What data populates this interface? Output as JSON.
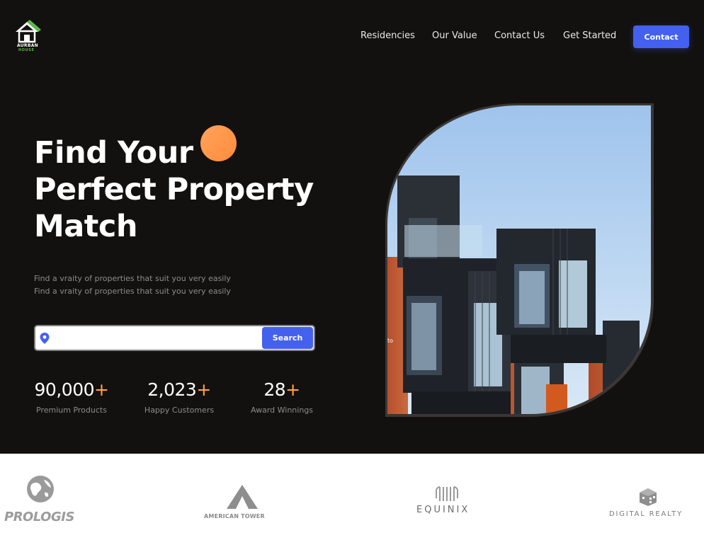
{
  "brand": {
    "name_line1": "AURBAN",
    "name_line2": "HOUSE",
    "accent_green": "#5db94a"
  },
  "nav": {
    "items": [
      {
        "label": "Residencies"
      },
      {
        "label": "Our Value"
      },
      {
        "label": "Contact Us"
      },
      {
        "label": "Get Started"
      }
    ],
    "cta_label": "Contact"
  },
  "hero": {
    "title_line1": "Find Your",
    "title_line2": "Perfect Property",
    "title_line3": "Match",
    "subtitle_line1": "Find a vraity of properties that suit you very easily",
    "subtitle_line2": "Find a vraity of properties that suit you very easily",
    "accent_orange": "#ff9a47",
    "search": {
      "placeholder": "",
      "value": "",
      "button_label": "Search"
    },
    "image_caption": "to",
    "stats": [
      {
        "value": "90,000",
        "suffix": "+",
        "label": "Premium Products"
      },
      {
        "value": "2,023",
        "suffix": "+",
        "label": "Happy Customers"
      },
      {
        "value": "28",
        "suffix": "+",
        "label": "Award Winnings"
      }
    ]
  },
  "partners": [
    {
      "name": "PROLOGIS",
      "icon": "globe-icon"
    },
    {
      "name": "AMERICAN TOWER",
      "icon": "tower-icon"
    },
    {
      "name": "EQUINIX",
      "icon": "equinix-icon"
    },
    {
      "name": "DIGITAL REALTY",
      "icon": "cube-icon"
    }
  ],
  "colors": {
    "background": "#131110",
    "primary_blue": "#4361ee",
    "text_muted": "#8c8c8c"
  }
}
